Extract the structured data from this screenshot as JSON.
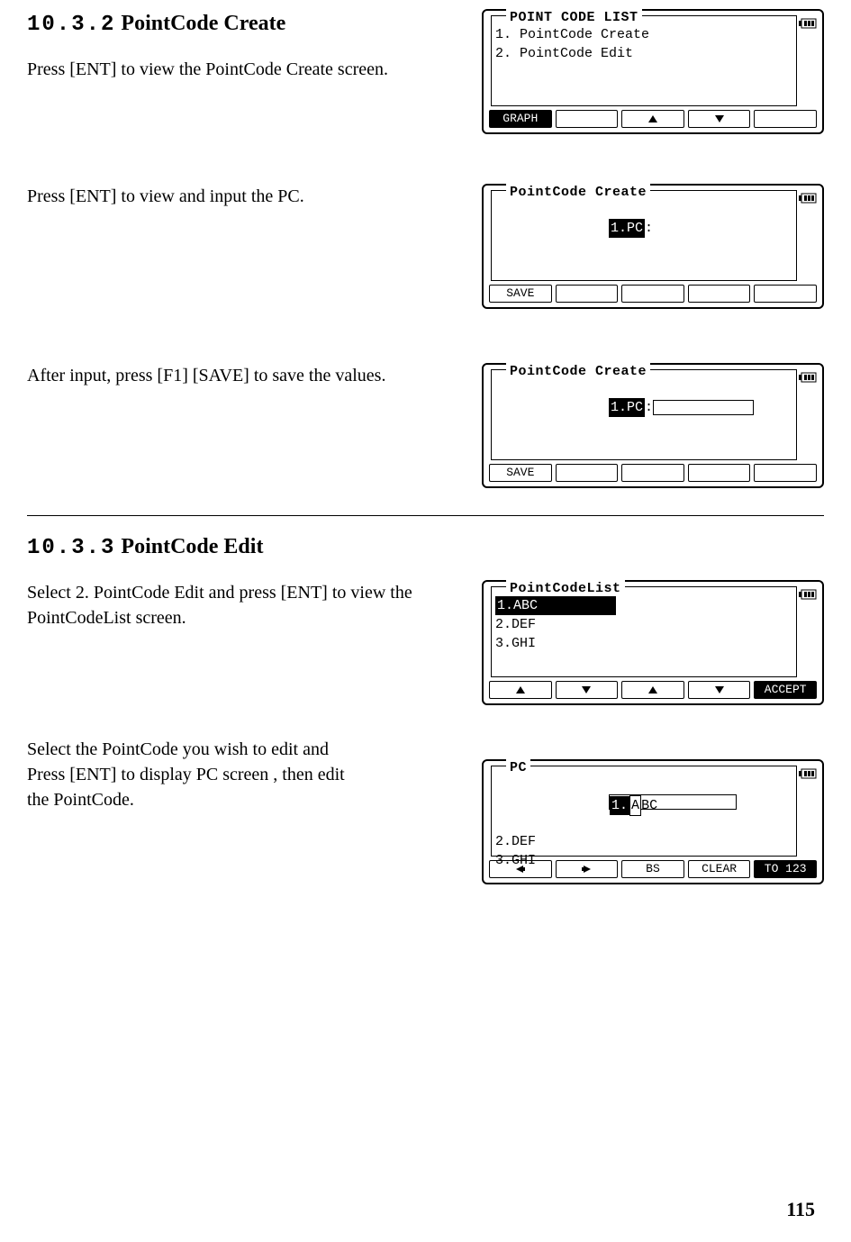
{
  "sections": {
    "s1": {
      "num": "10.3.2",
      "title": "PointCode Create"
    },
    "s2": {
      "num": "10.3.3",
      "title": "PointCode Edit"
    }
  },
  "para": {
    "p1": "Press [ENT] to view the PointCode Create screen.",
    "p2": "Press [ENT] to view and input the PC.",
    "p3": "After input, press [F1] [SAVE] to save the values.",
    "p4": "Select 2. PointCode Edit and press [ENT] to view the PointCodeList screen.",
    "p5a": "Select the PointCode you wish to edit and",
    "p5b": "Press [ENT] to display PC screen , then edit",
    "p5c": "the PointCode."
  },
  "lcd": {
    "s1": {
      "legend": "POINT CODE LIST",
      "line1": "1. PointCode Create",
      "line2": "2. PointCode Edit",
      "fkeys": {
        "f1": "GRAPH",
        "f2": "",
        "f3": "↑",
        "f4": "↓",
        "f5": ""
      }
    },
    "s2": {
      "legend": "PointCode Create",
      "field": "1.PC",
      "colon": ":",
      "fkeys": {
        "f1": "SAVE",
        "f2": "",
        "f3": "",
        "f4": "",
        "f5": ""
      }
    },
    "s3": {
      "legend": "PointCode Create",
      "field": "1.PC",
      "colon": ":",
      "fkeys": {
        "f1": "SAVE",
        "f2": "",
        "f3": "",
        "f4": "",
        "f5": ""
      }
    },
    "s4": {
      "legend": "PointCodeList",
      "item1": "1.ABC",
      "item2": "2.DEF",
      "item3": "3.GHI",
      "fkeys": {
        "f1": "▲",
        "f2": "▼",
        "f3": "↑",
        "f4": "↓",
        "f5": "ACCEPT"
      }
    },
    "s5": {
      "legend": "PC",
      "item1_prefix": "1.",
      "item1_cursor": "A",
      "item1_rest": "BC",
      "item2": "2.DEF",
      "item3": "3.GHI",
      "fkeys": {
        "f1": "←",
        "f2": "→",
        "f3": "BS",
        "f4": "CLEAR",
        "f5": "TO 123"
      }
    }
  },
  "page_number": "115"
}
